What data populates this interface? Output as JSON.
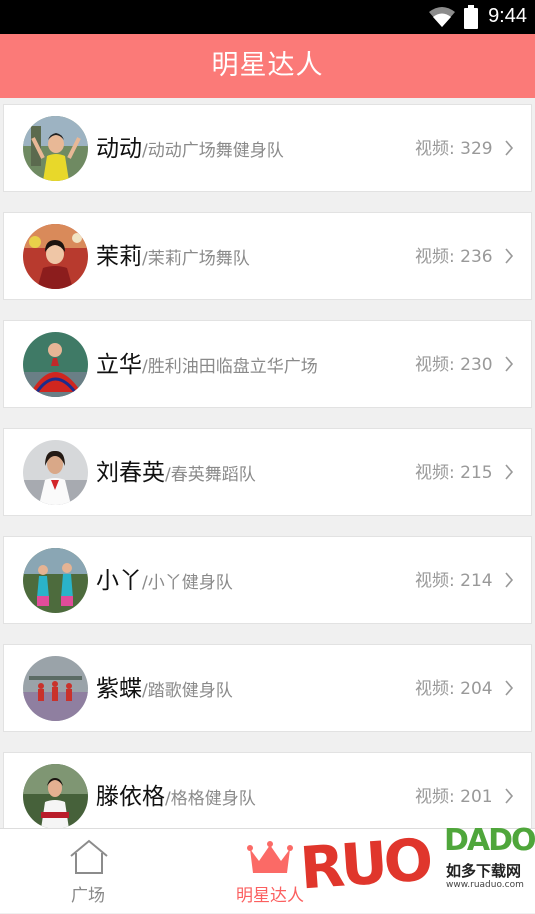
{
  "status_bar": {
    "time": "9:44",
    "wifi_icon": "wifi-icon",
    "battery_icon": "battery-icon"
  },
  "header": {
    "title": "明星达人"
  },
  "stars": [
    {
      "name": "动动",
      "separator": "/",
      "team": "动动广场舞健身队",
      "video_label": "视频:",
      "video_count": "329"
    },
    {
      "name": "茉莉",
      "separator": "/",
      "team": "茉莉广场舞队",
      "video_label": "视频:",
      "video_count": "236"
    },
    {
      "name": "立华",
      "separator": "/",
      "team": "胜利油田临盘立华广场",
      "video_label": "视频:",
      "video_count": "230"
    },
    {
      "name": "刘春英",
      "separator": "/",
      "team": "春英舞蹈队",
      "video_label": "视频:",
      "video_count": "215"
    },
    {
      "name": "小丫",
      "separator": "/",
      "team": "小丫健身队",
      "video_label": "视频:",
      "video_count": "214"
    },
    {
      "name": "紫蝶",
      "separator": "/",
      "team": "踏歌健身队",
      "video_label": "视频:",
      "video_count": "204"
    },
    {
      "name": "滕依格",
      "separator": "/",
      "team": "格格健身队",
      "video_label": "视频:",
      "video_count": "201"
    }
  ],
  "tabbar": {
    "tabs": [
      {
        "label": "广场",
        "icon": "house-icon",
        "active": false
      },
      {
        "label": "明星达人",
        "icon": "crown-icon",
        "active": true
      }
    ]
  },
  "watermark": {
    "logo": "RUO",
    "brand": "DADO",
    "cn": "如多下载网",
    "url": "www.ruaduo.com"
  },
  "colors": {
    "accent": "#fb7a78",
    "active_tab": "#fb6060",
    "background": "#f0f0f0"
  }
}
